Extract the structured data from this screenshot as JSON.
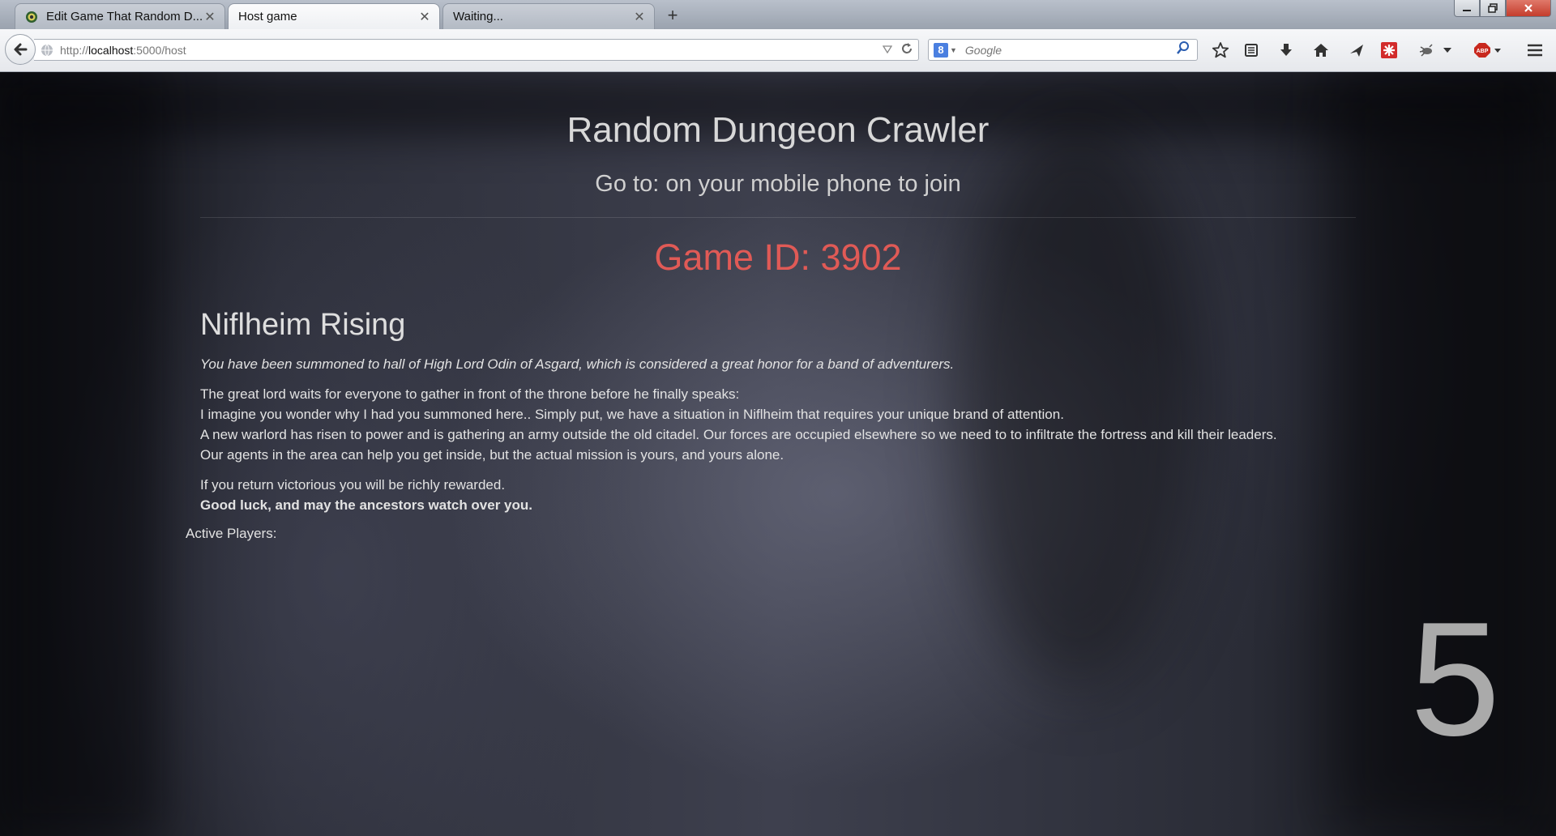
{
  "browser": {
    "tabs": [
      {
        "label": "Edit Game That Random D...",
        "active": false,
        "icon": "sync-favicon-icon"
      },
      {
        "label": "Host game",
        "active": true
      },
      {
        "label": "Waiting...",
        "active": false
      }
    ],
    "close_glyph": "✕",
    "new_tab_glyph": "+",
    "address": {
      "prefix": "http://",
      "host": "localhost",
      "path": ":5000/host"
    },
    "search": {
      "placeholder": "Google",
      "engine_letter": "8"
    },
    "toolbar_icons": [
      "bookmark-star-icon",
      "reading-list-icon",
      "download-icon",
      "home-icon",
      "send-icon",
      "addon-red-icon",
      "firebug-icon",
      "dropdown-icon",
      "adblock-icon",
      "menu-icon"
    ],
    "accent_close": "#c43c2c"
  },
  "page": {
    "title": "Random Dungeon Crawler",
    "subtitle": "Go to: on your mobile phone to join",
    "game_id": "Game ID: 3902",
    "game_id_color": "#e05a56",
    "story": {
      "title": "Niflheim Rising",
      "intro": "You have been summoned to hall of High Lord Odin of Asgard, which is considered a great honor for a band of adventurers.",
      "body_lines": [
        "The great lord waits for everyone to gather in front of the throne before he finally speaks:",
        "I imagine you wonder why I had you summoned here.. Simply put, we have a situation in Niflheim that requires your unique brand of attention.",
        "A new warlord has risen to power and is gathering an army outside the old citadel. Our forces are occupied elsewhere so we need to to infiltrate the fortress and kill their leaders.",
        "Our agents in the area can help you get inside, but the actual mission is yours, and yours alone."
      ],
      "reward": "If you return victorious you will be richly rewarded.",
      "farewell": "Good luck, and may the ancestors watch over you."
    },
    "active_players_label": "Active Players:",
    "countdown": "5"
  }
}
